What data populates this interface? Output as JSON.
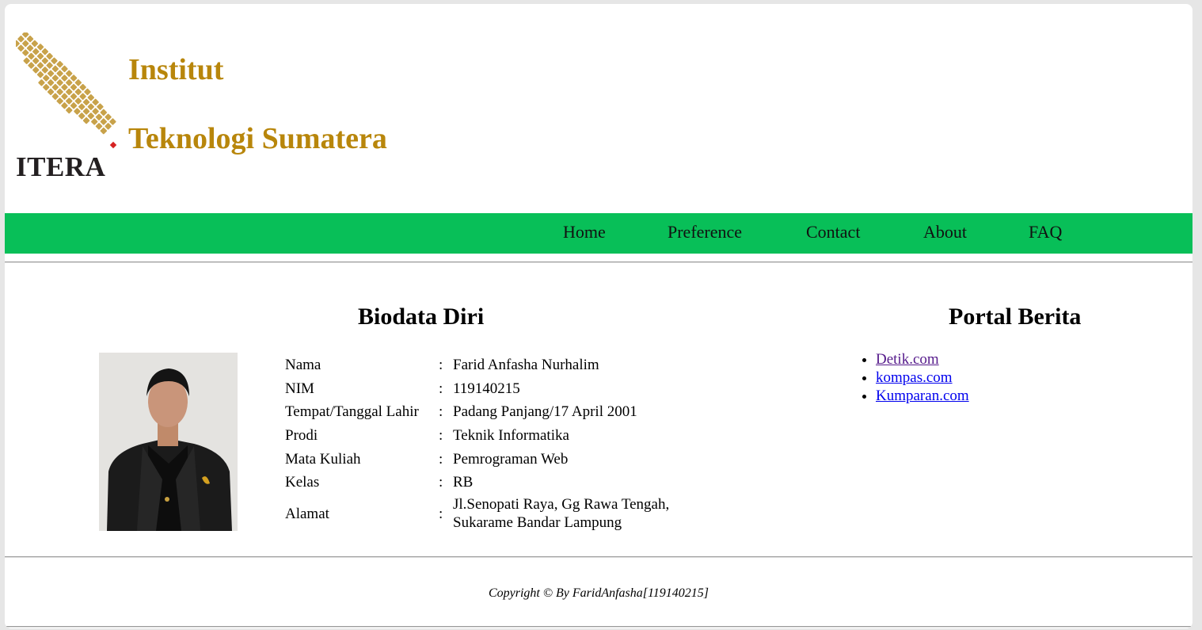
{
  "header": {
    "logo_text": "ITERA",
    "brand_line_1": "Institut",
    "brand_line_2": "Teknologi Sumatera",
    "brand_color": "#b8860b"
  },
  "nav": {
    "background": "#08bf58",
    "items": [
      "Home",
      "Preference",
      "Contact",
      "About",
      "FAQ"
    ]
  },
  "biodata": {
    "title": "Biodata Diri",
    "photo_icon": "profile-photo",
    "rows": [
      {
        "label": "Nama",
        "sep": ":",
        "value": "Farid Anfasha Nurhalim"
      },
      {
        "label": "NIM",
        "sep": ":",
        "value": "119140215"
      },
      {
        "label": "Tempat/Tanggal Lahir",
        "sep": ":",
        "value": "Padang Panjang/17 April 2001"
      },
      {
        "label": "Prodi",
        "sep": ":",
        "value": "Teknik Informatika"
      },
      {
        "label": "Mata Kuliah",
        "sep": ":",
        "value": "Pemrograman Web"
      },
      {
        "label": "Kelas",
        "sep": ":",
        "value": "RB"
      },
      {
        "label": "Alamat",
        "sep": ":",
        "value": "Jl.Senopati Raya, Gg Rawa Tengah, Sukarame Bandar Lampung"
      }
    ]
  },
  "portal": {
    "title": "Portal Berita",
    "links": [
      {
        "label": "Detik.com",
        "visited": true
      },
      {
        "label": "kompas.com",
        "visited": false
      },
      {
        "label": "Kumparan.com",
        "visited": false
      }
    ]
  },
  "footer": {
    "copyright": "Copyright © By FaridAnfasha[119140215]"
  }
}
